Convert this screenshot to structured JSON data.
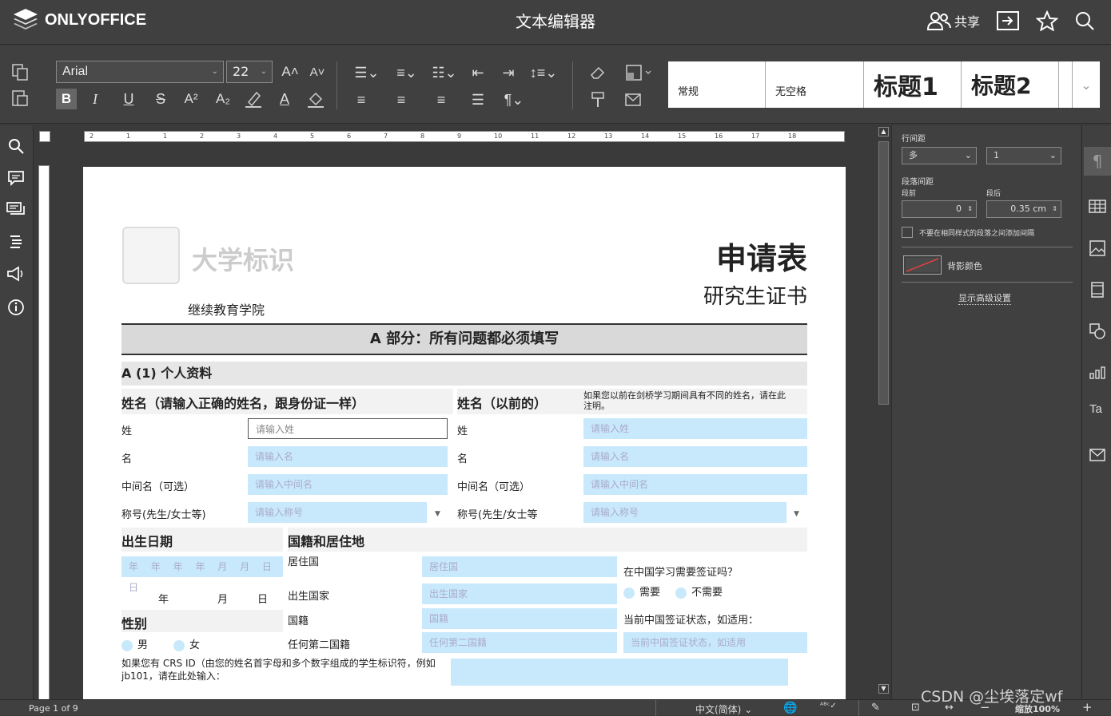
{
  "topbar": {
    "logo": "ONLYOFFICE",
    "title": "文本编辑器",
    "share_label": "共享"
  },
  "toolbar": {
    "font_name": "Arial",
    "font_size": "22",
    "styles": [
      {
        "label": "常规"
      },
      {
        "label": "无空格"
      },
      {
        "label": "标题1"
      },
      {
        "label": "标题2"
      }
    ]
  },
  "ruler_numbers": [
    "2",
    "1",
    "1",
    "2",
    "3",
    "4",
    "5",
    "6",
    "7",
    "8",
    "9",
    "10",
    "11",
    "12",
    "13",
    "14",
    "15",
    "16",
    "17",
    "18"
  ],
  "right_panel": {
    "line_spacing_label": "行间距",
    "line_spacing_mode": "多",
    "line_spacing_value": "1",
    "para_spacing_label": "段落间距",
    "before_label": "段前",
    "after_label": "段后",
    "before_value": "0",
    "after_value": "0.35 cm",
    "no_space_checkbox": "不要在相同样式的段落之间添加间隔",
    "bg_color_label": "背影颜色",
    "advanced_link": "显示高级设置"
  },
  "document": {
    "logo_placeholder": "大学标识",
    "school": "继续教育学院",
    "title": "申请表",
    "subtitle": "研究生证书",
    "section_a": "A 部分：所有问题都必须填写",
    "section_a1": "A (1) 个人资料",
    "name_heading": "姓名（请输入正确的姓名，跟身份证一样）",
    "prev_name_heading": "姓名（以前的）",
    "prev_name_note": "如果您以前在剑桥学习期间具有不同的姓名，请在此注明。",
    "surname": "姓",
    "given_name": "名",
    "middle_name": "中间名（可选）",
    "title_label": "称号(先生/女士等)",
    "title_label2": "称号(先生/女士等",
    "ph_surname": "请输入姓",
    "ph_given": "请输入名",
    "ph_middle": "请输入中间名",
    "ph_title": "请输入称号",
    "dob_heading": "出生日期",
    "dob_placeholder": "年 年 年 年 月 月 日 日",
    "year": "年",
    "month": "月",
    "day": "日",
    "nationality_heading": "国籍和居住地",
    "residence_country": "居住国",
    "birth_country": "出生国家",
    "nationality": "国籍",
    "second_nationality": "任何第二国籍",
    "ph_residence": "居住国",
    "ph_birth": "出生国家",
    "ph_nationality": "国籍",
    "ph_second": "任何第二国籍",
    "visa_question": "在中国学习需要签证吗？",
    "visa_yes": "需要",
    "visa_no": "不需要",
    "visa_status_label": "当前中国签证状态，如适用：",
    "ph_visa_status": "当前中国签证状态，如适用",
    "gender_heading": "性别",
    "male": "男",
    "female": "女",
    "crs_note": "如果您有 CRS ID（由您的姓名首字母和多个数字组成的学生标识符，例如 jb101，请在此处输入："
  },
  "statusbar": {
    "page": "Page 1 of 9",
    "language": "中文(简体)",
    "zoom": "缩放100%",
    "watermark": "CSDN @尘埃落定wf"
  }
}
